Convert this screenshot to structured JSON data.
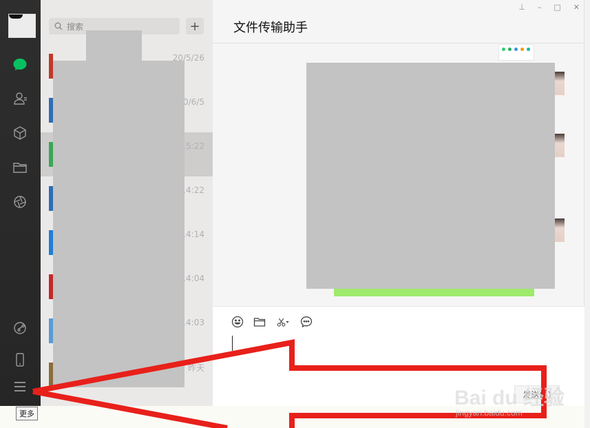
{
  "sidebar": {
    "items": [
      {
        "name": "chat",
        "icon": "chat-bubble-icon",
        "color": "#07c160"
      },
      {
        "name": "contacts",
        "icon": "contacts-icon"
      },
      {
        "name": "favorites",
        "icon": "cube-icon"
      },
      {
        "name": "files",
        "icon": "folder-icon"
      },
      {
        "name": "moments",
        "icon": "aperture-icon"
      }
    ],
    "bottom_items": [
      {
        "name": "mini-programs",
        "icon": "mini-program-icon"
      },
      {
        "name": "phone",
        "icon": "phone-icon"
      },
      {
        "name": "more",
        "icon": "menu-icon"
      }
    ],
    "more_tooltip": "更多"
  },
  "chat_list": {
    "search_placeholder": "搜索",
    "add_label": "+",
    "items": [
      {
        "time": "20/5/26",
        "avatar_color": "#c0392b"
      },
      {
        "time": "0/6/5",
        "avatar_color": "#2f6db5"
      },
      {
        "time": "15:22",
        "avatar_color": "#3aa757",
        "active": true
      },
      {
        "time": "14:22",
        "avatar_color": "#2f6db5"
      },
      {
        "time": "14:14",
        "avatar_color": "#1e7fd6"
      },
      {
        "time": "14:04",
        "avatar_color": "#c62828"
      },
      {
        "time": "14:03",
        "avatar_color": "#5b9bd5"
      },
      {
        "time": "昨天",
        "avatar_color": "#8a6d3b"
      }
    ]
  },
  "conversation": {
    "title": "文件传输助手",
    "window_controls": {
      "pin": "⊥",
      "minimize": "–",
      "maximize": "□",
      "close": "✕"
    },
    "send_label": "发送(S)"
  },
  "annotation": {
    "arrow_color": "#e8201a",
    "watermark": "Bai du 经验",
    "watermark_sub": "jingyan.baidu.com"
  }
}
